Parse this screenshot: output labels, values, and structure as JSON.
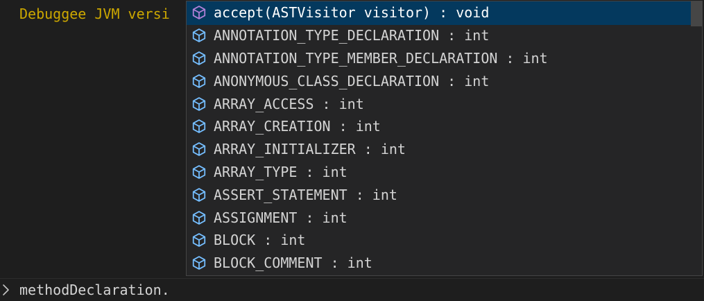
{
  "console": {
    "output_line": "Debuggee JVM versi"
  },
  "suggest": {
    "items": [
      {
        "label": "accept(ASTVisitor visitor) : void",
        "kind": "method",
        "icon": "method-cube-icon",
        "selected": true
      },
      {
        "label": "ANNOTATION_TYPE_DECLARATION : int",
        "kind": "field",
        "icon": "field-cube-icon",
        "selected": false
      },
      {
        "label": "ANNOTATION_TYPE_MEMBER_DECLARATION : int",
        "kind": "field",
        "icon": "field-cube-icon",
        "selected": false
      },
      {
        "label": "ANONYMOUS_CLASS_DECLARATION : int",
        "kind": "field",
        "icon": "field-cube-icon",
        "selected": false
      },
      {
        "label": "ARRAY_ACCESS : int",
        "kind": "field",
        "icon": "field-cube-icon",
        "selected": false
      },
      {
        "label": "ARRAY_CREATION : int",
        "kind": "field",
        "icon": "field-cube-icon",
        "selected": false
      },
      {
        "label": "ARRAY_INITIALIZER : int",
        "kind": "field",
        "icon": "field-cube-icon",
        "selected": false
      },
      {
        "label": "ARRAY_TYPE : int",
        "kind": "field",
        "icon": "field-cube-icon",
        "selected": false
      },
      {
        "label": "ASSERT_STATEMENT : int",
        "kind": "field",
        "icon": "field-cube-icon",
        "selected": false
      },
      {
        "label": "ASSIGNMENT : int",
        "kind": "field",
        "icon": "field-cube-icon",
        "selected": false
      },
      {
        "label": "BLOCK : int",
        "kind": "field",
        "icon": "field-cube-icon",
        "selected": false
      },
      {
        "label": "BLOCK_COMMENT : int",
        "kind": "field",
        "icon": "field-cube-icon",
        "selected": false
      }
    ]
  },
  "input": {
    "prompt_icon": "chevron-right-icon",
    "value": "methodDeclaration."
  },
  "colors": {
    "background": "#1e1e1e",
    "widget_background": "#252526",
    "selected_row": "#04395e",
    "output_text": "#cca700",
    "method_icon": "#b180d7",
    "field_icon": "#75beff",
    "text": "#d4d4d4"
  }
}
